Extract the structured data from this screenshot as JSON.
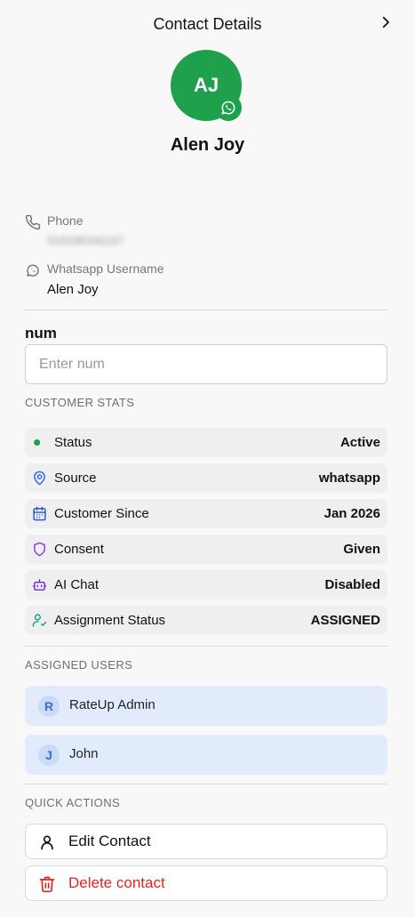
{
  "header": {
    "title": "Contact Details"
  },
  "contact": {
    "initials": "AJ",
    "name": "Alen Joy",
    "phone_label": "Phone",
    "phone_value": "919188346167",
    "whatsapp_label": "Whatsapp Username",
    "whatsapp_value": "Alen Joy"
  },
  "custom_field": {
    "label": "num",
    "placeholder": "Enter num"
  },
  "customer_stats": {
    "title": "CUSTOMER STATS",
    "rows": [
      {
        "label": "Status",
        "value": "Active",
        "icon": "status-dot-icon"
      },
      {
        "label": "Source",
        "value": "whatsapp",
        "icon": "map-pin-icon"
      },
      {
        "label": "Customer Since",
        "value": "Jan 2026",
        "icon": "calendar-icon"
      },
      {
        "label": "Consent",
        "value": "Given",
        "icon": "shield-icon"
      },
      {
        "label": "AI Chat",
        "value": "Disabled",
        "icon": "bot-icon"
      },
      {
        "label": "Assignment Status",
        "value": "ASSIGNED",
        "icon": "user-check-icon"
      }
    ]
  },
  "assigned_users": {
    "title": "ASSIGNED USERS",
    "users": [
      {
        "initial": "R",
        "name": "RateUp Admin"
      },
      {
        "initial": "J",
        "name": "John"
      }
    ]
  },
  "quick_actions": {
    "title": "QUICK ACTIONS",
    "edit_label": "Edit Contact",
    "delete_label": "Delete contact"
  },
  "colors": {
    "brand_green": "#1ea04c",
    "status_green": "#16a34a",
    "source_blue": "#2563eb",
    "calendar_blue": "#1d4ed8",
    "consent_purple": "#9333ea",
    "ai_purple": "#6d28d9",
    "assignment_teal": "#0f9d8a",
    "danger_red": "#dc2626",
    "user_card_bg": "#e2ebfb"
  }
}
